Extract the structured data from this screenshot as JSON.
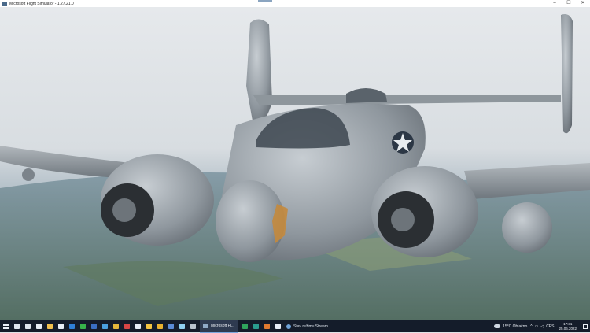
{
  "window": {
    "title": "Microsoft Flight Simulator - 1.27.21.0",
    "minimize": "–",
    "maximize": "☐",
    "close": "✕"
  },
  "taskbar": {
    "apps": [
      {
        "name": "search-icon",
        "color": "#dfe6ee"
      },
      {
        "name": "task-view-icon",
        "color": "#dfe6ee"
      },
      {
        "name": "onedrive-icon",
        "color": "#e8eef6"
      },
      {
        "name": "file-explorer-icon",
        "color": "#f2c14e"
      },
      {
        "name": "notepad-icon",
        "color": "#e8eef6"
      },
      {
        "name": "outlook-icon",
        "color": "#2f7fd6"
      },
      {
        "name": "whatsapp-icon",
        "color": "#36b34a"
      },
      {
        "name": "app-blue-icon",
        "color": "#3a6fc4"
      },
      {
        "name": "app-cross-icon",
        "color": "#4aa0e0"
      },
      {
        "name": "app-yellow-icon",
        "color": "#e3b53a"
      },
      {
        "name": "shield-app-icon",
        "color": "#d64545"
      },
      {
        "name": "calendar-app-icon",
        "color": "#e8eef6"
      },
      {
        "name": "folder-icon",
        "color": "#f5c542"
      },
      {
        "name": "chrome-icon",
        "color": "#e9b12f"
      },
      {
        "name": "docs-icon",
        "color": "#5b8bd6"
      },
      {
        "name": "notes-icon",
        "color": "#8fd0f0"
      },
      {
        "name": "app-gray-icon",
        "color": "#b8c2cc"
      }
    ],
    "active_task": "Microsoft Fl...",
    "after_apps": [
      {
        "name": "excel-icon",
        "color": "#2fa35c"
      },
      {
        "name": "app-green-icon",
        "color": "#2a9c8e"
      },
      {
        "name": "app-orange-icon",
        "color": "#e07a2f"
      },
      {
        "name": "app-white-icon",
        "color": "#e8eef6"
      }
    ],
    "stream_task": "Stav režimu Stream...",
    "tray": {
      "weather": "15°C  Oblačno",
      "chevron": "^",
      "lang": "CES",
      "time": "17:31",
      "date": "25.06.2022"
    }
  },
  "colors": {
    "accent": "#7aa7de",
    "taskbar_bg": "#141c2a"
  }
}
